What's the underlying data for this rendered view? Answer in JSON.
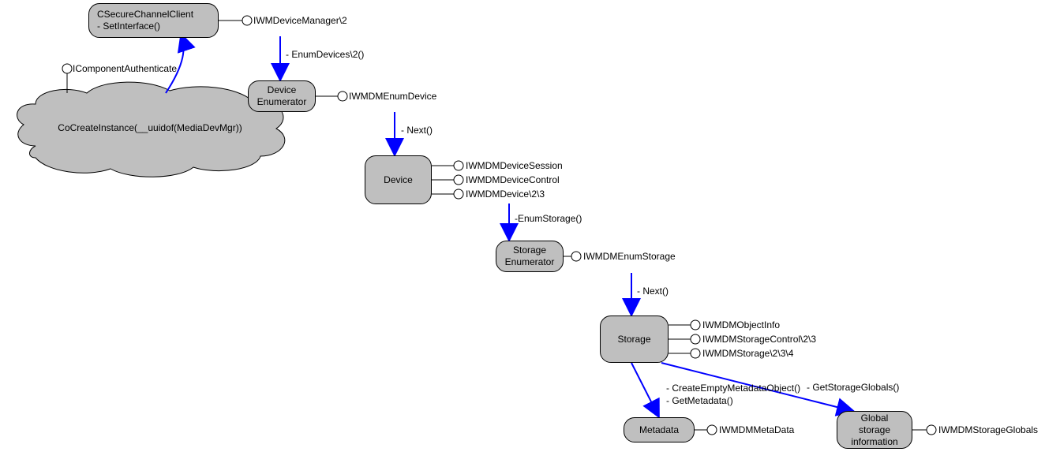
{
  "nodes": {
    "secure": {
      "line1": "CSecureChannelClient",
      "line2": "- SetInterface()"
    },
    "cloud": {
      "text": "CoCreateInstance(__uuidof(MediaDevMgr))"
    },
    "devEnum": {
      "line1": "Device",
      "line2": "Enumerator"
    },
    "device": {
      "text": "Device"
    },
    "storEnum": {
      "line1": "Storage",
      "line2": "Enumerator"
    },
    "storage": {
      "text": "Storage"
    },
    "metadata": {
      "text": "Metadata"
    },
    "globals": {
      "line1": "Global",
      "line2": "storage",
      "line3": "information"
    }
  },
  "interfaces": {
    "compAuth": "IComponentAuthenticate",
    "devMgr": "IWMDeviceManager\\2",
    "enumDevice": "IWMDMEnumDevice",
    "devSession": "IWMDMDeviceSession",
    "devControl": "IWMDMDeviceControl",
    "devVersions": "IWMDMDevice\\2\\3",
    "enumStorage": "IWMDMEnumStorage",
    "objInfo": "IWMDMObjectInfo",
    "storControl": "IWMDMStorageControl\\2\\3",
    "storVersions": "IWMDMStorage\\2\\3\\4",
    "metaData": "IWMDMMetaData",
    "storGlobals": "IWMDMStorageGlobals"
  },
  "edges": {
    "enumDevices": "- EnumDevices\\2()",
    "next1": "- Next()",
    "enumStorage": "-EnumStorage()",
    "next2": "- Next()",
    "createMeta": "- CreateEmptyMetadataObject()",
    "getMeta": "- GetMetadata()",
    "getStorGlobals": "- GetStorageGlobals()"
  }
}
